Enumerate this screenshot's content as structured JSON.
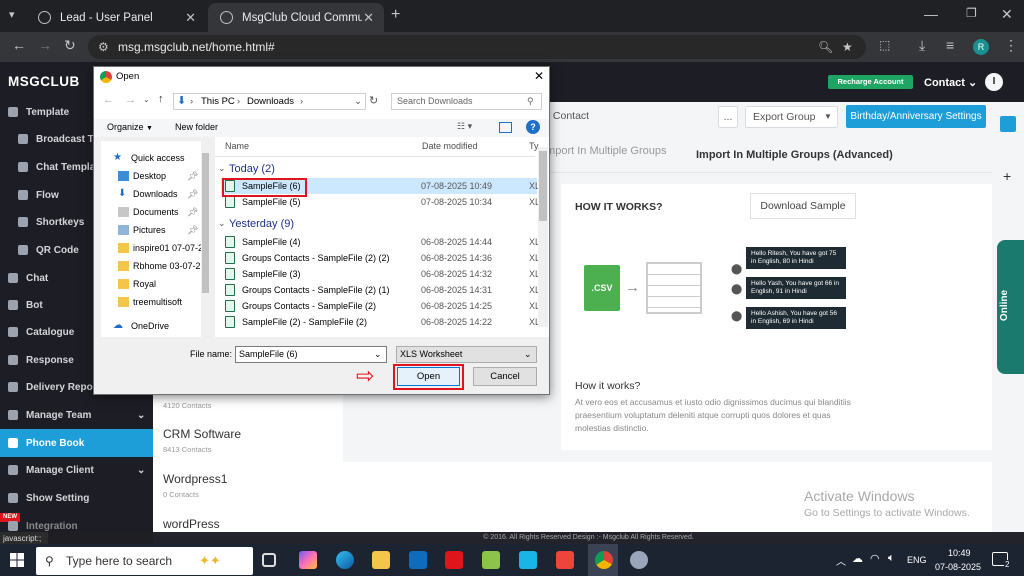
{
  "browser": {
    "tabs": [
      {
        "label": "Lead - User Panel"
      },
      {
        "label": "MsgClub Cloud Communicatio"
      }
    ],
    "url": "msg.msgclub.net/home.html#",
    "profile_initial": "R",
    "status_text": "javascript:;"
  },
  "app": {
    "logo": "MSGCLUB",
    "recharge_label": "Recharge Account",
    "contact_label": "Contact",
    "user_initial": "I",
    "sidebar": [
      {
        "label": "Template"
      },
      {
        "label": "Broadcast Te"
      },
      {
        "label": "Chat Templa"
      },
      {
        "label": "Flow"
      },
      {
        "label": "Shortkeys"
      },
      {
        "label": "QR Code"
      },
      {
        "label": "Chat"
      },
      {
        "label": "Bot"
      },
      {
        "label": "Catalogue"
      },
      {
        "label": "Response"
      },
      {
        "label": "Delivery Repor"
      },
      {
        "label": "Manage Team"
      },
      {
        "label": "Phone Book"
      },
      {
        "label": "Manage Client"
      },
      {
        "label": "Show Setting"
      },
      {
        "label": "Integration"
      }
    ],
    "new_badge": "NEW",
    "toolbar": {
      "contact": "Contact",
      "ellipsis": "...",
      "export_group": "Export Group",
      "birthday": "Birthday/Anniversary Settings"
    },
    "tabs": {
      "multi": "Import In Multiple Groups",
      "advanced": "Import In Multiple Groups (Advanced)"
    },
    "how": {
      "title": "HOW IT WORKS?",
      "download": "Download Sample",
      "csv": ".CSV",
      "msg1": "Hello Ritesh, You have got 75 in English, 80 in Hindi",
      "msg2": "Hello Yash, You have got 66 in English, 91 in Hindi",
      "msg3": "Hello Ashish, You have got 56 in English, 69 in Hindi",
      "subtitle": "How it works?",
      "body": "At vero eos et accusamus et iusto odio dignissimos ducimus qui blanditiis praesentium voluptatum deleniti atque corrupti quos dolores et quas molestias distinctio."
    },
    "groups": [
      {
        "name": "",
        "count": "4120 Contacts"
      },
      {
        "name": "CRM Software",
        "count": "8413 Contacts"
      },
      {
        "name": "Wordpress1",
        "count": "0 Contacts"
      },
      {
        "name": "wordPress",
        "count": ""
      }
    ],
    "online": "Online",
    "footer": "© 2016. All Rights Reserved Design :- Msgclub All Rights Reserved.",
    "watermark_title": "Activate Windows",
    "watermark_sub": "Go to Settings to activate Windows."
  },
  "dialog": {
    "title": "Open",
    "breadcrumb": [
      "This PC",
      "Downloads"
    ],
    "search_placeholder": "Search Downloads",
    "organize": "Organize",
    "new_folder": "New folder",
    "nav": [
      {
        "label": "Quick access"
      },
      {
        "label": "Desktop"
      },
      {
        "label": "Downloads"
      },
      {
        "label": "Documents"
      },
      {
        "label": "Pictures"
      },
      {
        "label": "inspire01 07-07-2"
      },
      {
        "label": "Rbhome 03-07-2"
      },
      {
        "label": "Royal"
      },
      {
        "label": "treemultisoft"
      },
      {
        "label": "OneDrive"
      }
    ],
    "columns": {
      "name": "Name",
      "date": "Date modified",
      "type": "Ty"
    },
    "groups": {
      "today": "Today (2)",
      "yesterday": "Yesterday (9)"
    },
    "files": [
      {
        "name": "SampleFile (6)",
        "date": "07-08-2025 10:49",
        "type": "XL"
      },
      {
        "name": "SampleFile (5)",
        "date": "07-08-2025 10:34",
        "type": "XL"
      },
      {
        "name": "SampleFile (4)",
        "date": "06-08-2025 14:44",
        "type": "XL"
      },
      {
        "name": "Groups Contacts - SampleFile (2) (2)",
        "date": "06-08-2025 14:36",
        "type": "XL"
      },
      {
        "name": "SampleFile (3)",
        "date": "06-08-2025 14:32",
        "type": "XL"
      },
      {
        "name": "Groups Contacts - SampleFile (2) (1)",
        "date": "06-08-2025 14:31",
        "type": "XL"
      },
      {
        "name": "Groups Contacts - SampleFile (2)",
        "date": "06-08-2025 14:25",
        "type": "XL"
      },
      {
        "name": "SampleFile (2) - SampleFile (2)",
        "date": "06-08-2025 14:22",
        "type": "XL"
      }
    ],
    "file_name_label": "File name:",
    "file_name_value": "SampleFile (6)",
    "file_type": "XLS Worksheet",
    "open": "Open",
    "cancel": "Cancel"
  },
  "taskbar": {
    "search_placeholder": "Type here to search",
    "lang": "ENG",
    "time": "10:49",
    "date": "07-08-2025",
    "notif": "2"
  }
}
